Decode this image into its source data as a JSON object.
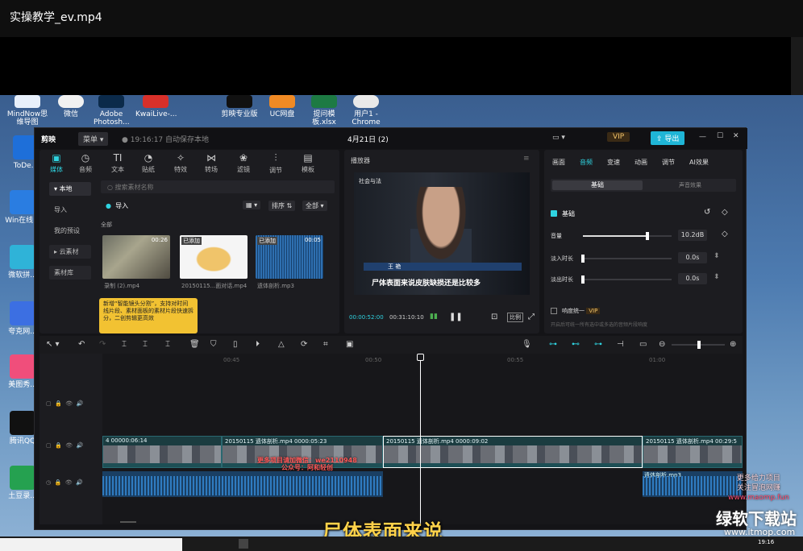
{
  "player_title": "实操教学_ev.mp4",
  "desktop": {
    "top_icons": [
      "MindNow思维导图",
      "微信",
      "Adobe Photosh...",
      "KwaiLive-...",
      "剪映专业版",
      "UC网盘",
      "提问模板.xlsx",
      "用户1 - Chrome"
    ],
    "left_icons": [
      "ToDe...",
      "Win在线...",
      "微软拼...",
      "夸克网...",
      "美图秀...",
      "腾讯QQ",
      "土豆录..."
    ]
  },
  "editor": {
    "app_name": "剪映",
    "menu_label": "菜单",
    "autosave": "19:16:17 自动保存本地",
    "project_title": "4月21日 (2)",
    "vip": "VIP",
    "export": "导出",
    "media_tabs": [
      "媒体",
      "音频",
      "文本",
      "贴纸",
      "特效",
      "转场",
      "滤镜",
      "调节",
      "模板"
    ],
    "side_items": [
      "本地",
      "导入",
      "我的预设",
      "云素材",
      "素材库"
    ],
    "search_placeholder": "搜索素材名称",
    "import_label": "导入",
    "sort_label": "排序",
    "all_label": "全部",
    "section_all": "全部",
    "media_items": [
      {
        "duration": "00:26",
        "caption": "录制 (2).mp4",
        "badge": ""
      },
      {
        "duration": "",
        "caption": "20150115...面对话.mp4",
        "badge": "已添加"
      },
      {
        "duration": "00:05",
        "caption": "遗体剖析.mp3",
        "badge": "已添加"
      }
    ],
    "tip": "新增“智能镜头分割”，支持对时间线片段、素材面板的素材片段快速拆分，二创剪辑更高效",
    "player": {
      "title": "播放器",
      "current_time": "00:00:52:00",
      "total_time": "00:31:10:10",
      "ratio": "比例",
      "video_subtitle": "尸体表面来说皮肤缺损还是比较多",
      "video_watermark": "社会与法",
      "name_tag": "王 艳"
    },
    "props": {
      "tabs": [
        "画面",
        "音频",
        "变速",
        "动画",
        "调节",
        "AI效果"
      ],
      "active_tab": "音频",
      "subtabs": [
        "基础",
        "声音效果"
      ],
      "basic_label": "基础",
      "rows": [
        {
          "label": "音量",
          "value": "10.2dB",
          "fill": 0.73
        },
        {
          "label": "淡入时长",
          "value": "0.0s",
          "fill": 0.0
        },
        {
          "label": "淡出时长",
          "value": "0.0s",
          "fill": 0.0
        }
      ],
      "loudness_label": "响度统一",
      "loudness_note": "开启后可统一所有选中或多选的音频片段响度"
    },
    "timeline": {
      "ruler": [
        "00:45",
        "00:50",
        "00:55",
        "01:00"
      ],
      "clips": [
        {
          "label": "4  00000:06:14"
        },
        {
          "label": "20150115 遗体剖析.mp4  0000:05:23"
        },
        {
          "label": "20150115 遗体剖析.mp4  0000:09:02"
        },
        {
          "label": "20150115 遗体剖析.mp4  00:29:5"
        }
      ],
      "overlay_text": "更多项目请加微信：we2110948",
      "overlay_text2": "公众号：阿和轻创",
      "audio_label": "遗体剖析.mp3"
    }
  },
  "subtitle": "尸体表面来说",
  "watermarks": {
    "line1": "更多给力项目",
    "line2": "关注冒泡网赚",
    "line3": "www.maomp.fun",
    "site_name": "绿软下载站",
    "site_url": "www.itmop.com"
  },
  "taskbar_time": "19:16"
}
